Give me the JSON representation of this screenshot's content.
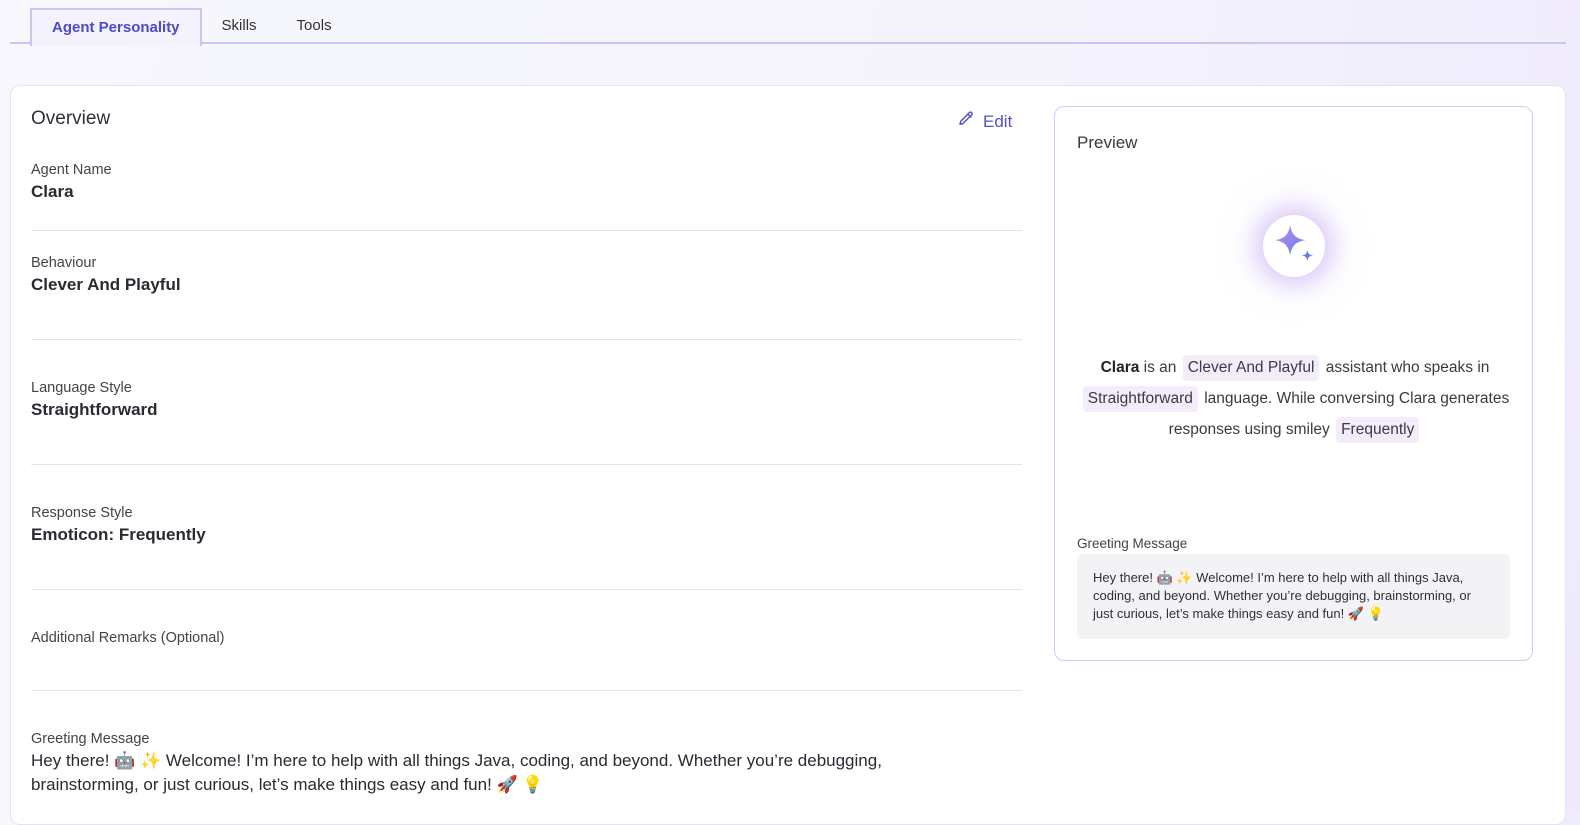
{
  "tabs": [
    {
      "label": "Agent Personality",
      "active": true
    },
    {
      "label": "Skills",
      "active": false
    },
    {
      "label": "Tools",
      "active": false
    }
  ],
  "overview": {
    "title": "Overview",
    "edit_label": "Edit",
    "fields": {
      "agent_name": {
        "label": "Agent Name",
        "value": "Clara"
      },
      "behaviour": {
        "label": "Behaviour",
        "value": "Clever And Playful"
      },
      "language_style": {
        "label": "Language Style",
        "value": "Straightforward"
      },
      "response_style": {
        "label": "Response Style",
        "value": "Emoticon: Frequently"
      },
      "additional_remarks": {
        "label": "Additional Remarks (Optional)",
        "value": ""
      },
      "greeting": {
        "label": "Greeting Message",
        "value": "Hey there! 🤖 ✨ Welcome! I’m here to help with all things Java, coding, and beyond. Whether you’re debugging, brainstorming, or just curious, let’s make things easy and fun! 🚀 💡"
      }
    }
  },
  "preview": {
    "title": "Preview",
    "name": "Clara",
    "text_is_an": "is an",
    "behaviour_chip": "Clever And Playful",
    "text_assistant": "assistant who speaks in",
    "language_chip": "Straightforward",
    "text_language": "language. While conversing Clara generates responses using smiley",
    "frequency_chip": "Frequently",
    "greeting_label": "Greeting Message",
    "greeting_text": "Hey there! 🤖 ✨ Welcome! I’m here to help with all things Java, coding, and beyond. Whether you’re debugging, brainstorming, or just curious, let’s make things easy and fun! 🚀 💡"
  },
  "colors": {
    "accent": "#5252c9",
    "chip_bg": "#f4ecfb",
    "tab_border": "#c9c6f2"
  },
  "icons": {
    "edit": "pencil-icon",
    "preview_avatar": "sparkle-icon"
  }
}
